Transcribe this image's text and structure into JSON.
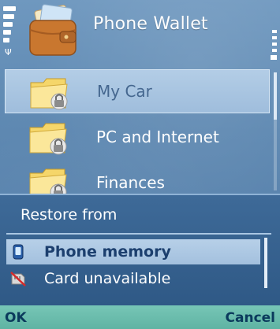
{
  "header": {
    "title": "Phone Wallet",
    "app_icon": "wallet-icon"
  },
  "list": {
    "items": [
      {
        "label": "My Car",
        "icon": "locked-folder-icon",
        "selected": true
      },
      {
        "label": "PC and Internet",
        "icon": "locked-folder-icon",
        "selected": false
      },
      {
        "label": "Finances",
        "icon": "locked-folder-icon",
        "selected": false
      }
    ]
  },
  "popup": {
    "title": "Restore from",
    "options": [
      {
        "label": "Phone memory",
        "icon": "phone-memory-icon",
        "selected": true
      },
      {
        "label": "Card unavailable",
        "icon": "memory-card-unavailable-icon",
        "selected": false
      }
    ]
  },
  "softkeys": {
    "left": "OK",
    "right": "Cancel"
  },
  "colors": {
    "background": "#5b86b0",
    "highlight": "#a3c0de",
    "softkey_bar": "#5fb3a3",
    "softkey_text": "#0b3a5c"
  }
}
